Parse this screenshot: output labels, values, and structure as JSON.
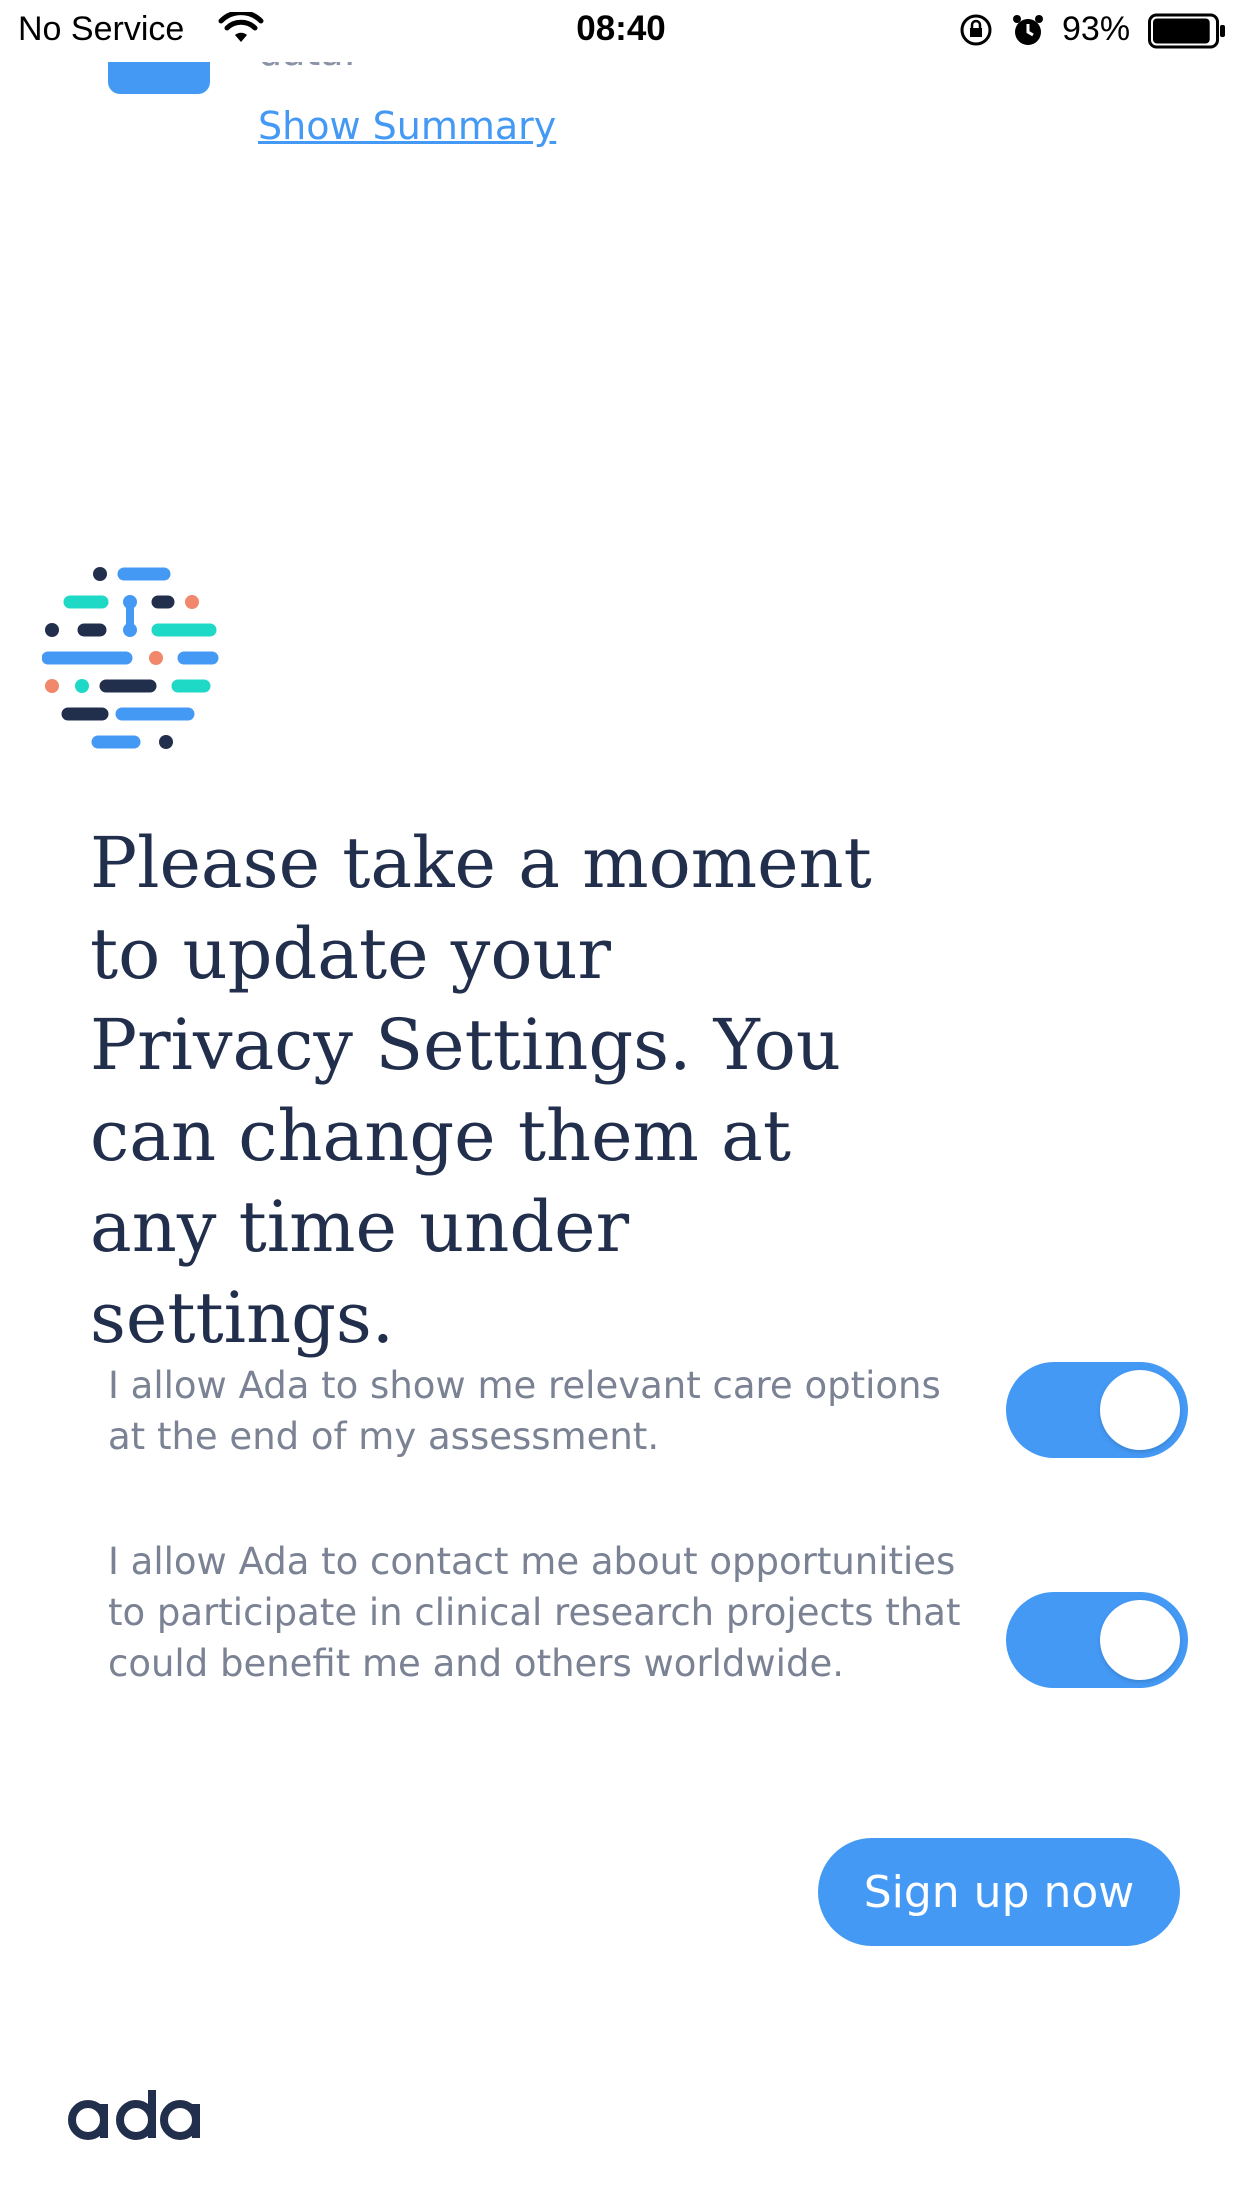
{
  "status_bar": {
    "carrier": "No Service",
    "time": "08:40",
    "battery_percent": "93%",
    "battery_level": 0.93,
    "icons": [
      "wifi-icon",
      "orientation-lock-icon",
      "alarm-icon",
      "battery-icon"
    ]
  },
  "top_section": {
    "data_fragment": "data.",
    "show_summary_link": "Show Summary"
  },
  "headline": "Please take a moment to update your Privacy Settings. You can change them at any time under settings.",
  "settings": [
    {
      "label": "I allow Ada to show me relevant care options at the end of my assessment.",
      "enabled": true
    },
    {
      "label": "I allow Ada to contact me about opportunities to participate in clinical research projects that could benefit me and others worldwide.",
      "enabled": true
    }
  ],
  "signup_button": "Sign up now",
  "brand": {
    "wordmark": "ada",
    "accent_color": "#4499f5",
    "navy_color": "#222f4c",
    "teal_color": "#1ed9c5",
    "coral_color": "#f1876b"
  }
}
